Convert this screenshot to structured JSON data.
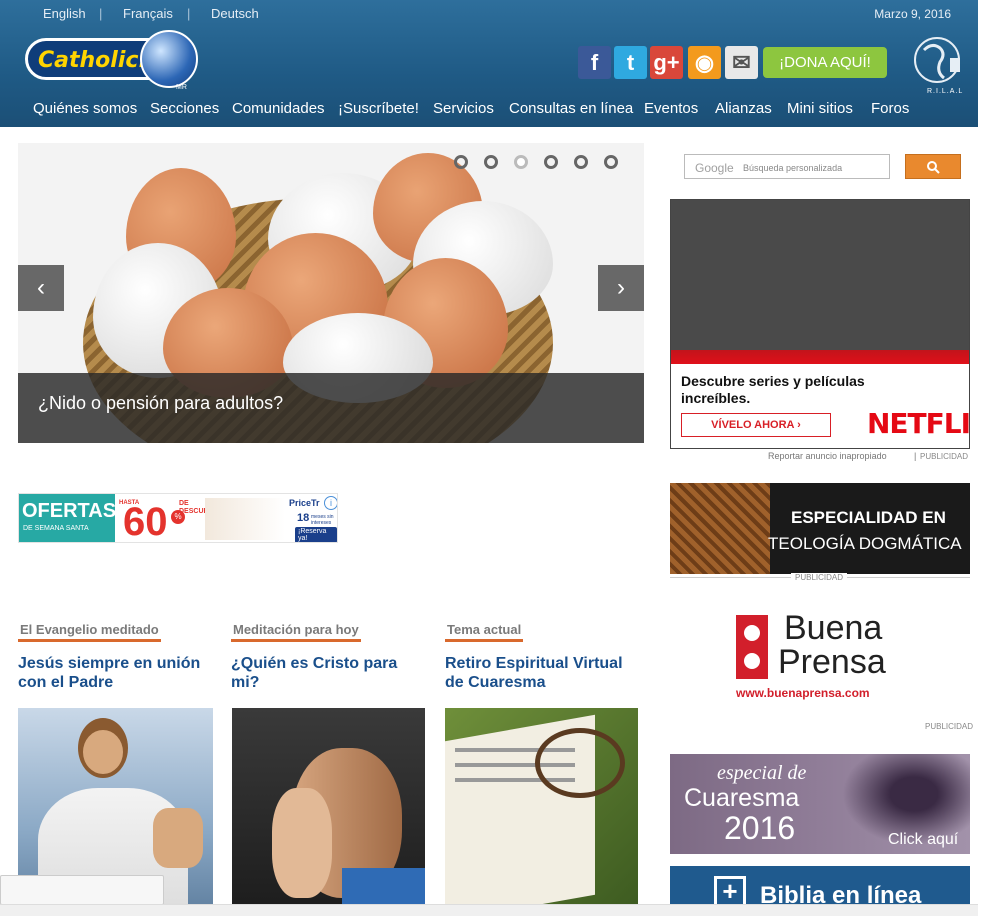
{
  "header": {
    "languages": [
      "English",
      "Français",
      "Deutsch"
    ],
    "date": "Marzo 9, 2016",
    "logo_text": "Catholic.net",
    "logo_mark": "MR",
    "donate_label": "¡DONA AQUÍ!",
    "rilal_label": "R.I.L.A.L",
    "social": [
      {
        "icon": "facebook-icon",
        "glyph": "f",
        "color": "#3b5998"
      },
      {
        "icon": "twitter-icon",
        "glyph": "t",
        "color": "#2fa9e0"
      },
      {
        "icon": "google-plus-icon",
        "glyph": "g+",
        "color": "#d9473a"
      },
      {
        "icon": "rss-icon",
        "glyph": "◉",
        "color": "#f39a1d"
      },
      {
        "icon": "email-icon",
        "glyph": "✉",
        "color": "#e8e8e8"
      }
    ]
  },
  "nav": [
    "Quiénes somos",
    "Secciones",
    "Comunidades",
    "¡Suscríbete!",
    "Servicios",
    "Consultas en línea",
    "Eventos",
    "Alianzas",
    "Mini sitios",
    "Foros"
  ],
  "slider": {
    "caption": "¿Nido o pensión para adultos?",
    "prev": "‹",
    "next": "›",
    "dots": 6,
    "active_dot": 3
  },
  "banner": {
    "ofertas": "OFERTAS",
    "semana": "DE SEMANA SANTA",
    "hasta": "HASTA",
    "percent": "60",
    "percent_sign": "%",
    "de": "DE",
    "descuento": "DESCUENTO",
    "brand": "PriceTr",
    "meses": "18",
    "meses_text": "meses sin intereses",
    "reserva": "¡Reserva ya!"
  },
  "sections": [
    {
      "heading": "El Evangelio meditado",
      "title": "Jesús siempre en unión con el Padre"
    },
    {
      "heading": "Meditación para hoy",
      "title": "¿Quién es Cristo para mi?"
    },
    {
      "heading": "Tema actual",
      "title": "Retiro Espiritual Virtual de Cuaresma"
    }
  ],
  "search": {
    "brand": "Google",
    "placeholder": "Búsqueda personalizada",
    "button_icon": "search-icon"
  },
  "netflix_ad": {
    "text": "Descubre series y películas increíbles.",
    "cta": "VÍVELO AHORA  ›",
    "brand": "NETFLIX",
    "report": "Reportar anuncio inapropiado",
    "publicidad": "PUBLICIDAD"
  },
  "teologia": {
    "line1": "ESPECIALIDAD EN",
    "line2": "TEOLOGÍA DOGMÁTICA",
    "publicidad": "PUBLICIDAD"
  },
  "buena_prensa": {
    "line1": "Buena",
    "line2": "Prensa",
    "url": "www.buenaprensa.com",
    "publicidad": "PUBLICIDAD"
  },
  "cuaresma": {
    "especial": "especial de",
    "title": "Cuaresma",
    "year": "2016",
    "cta": "Click aquí"
  },
  "biblia": {
    "title": "Biblia en línea"
  }
}
